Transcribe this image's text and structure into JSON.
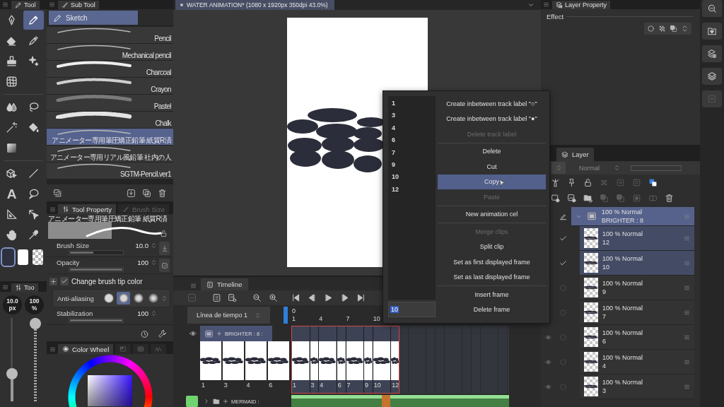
{
  "tool_panel": {
    "title": "Tool",
    "groups": [
      {
        "tools": [
          {
            "kind": "pen",
            "selected": false
          },
          {
            "kind": "pencil",
            "selected": true
          },
          {
            "kind": "eraser",
            "selected": false
          },
          {
            "kind": "marker",
            "selected": false
          },
          {
            "kind": "stamp",
            "selected": false
          },
          {
            "kind": "sparkle",
            "selected": false
          },
          {
            "kind": "mesh",
            "selected": false
          }
        ]
      },
      {
        "tools": [
          {
            "kind": "drops",
            "selected": false
          },
          {
            "kind": "lasso",
            "selected": false
          },
          {
            "kind": "wand",
            "selected": false
          },
          {
            "kind": "bucket",
            "selected": false
          },
          {
            "kind": "gradient",
            "selected": false
          }
        ]
      },
      {
        "tools": [
          {
            "kind": "cube",
            "selected": false
          },
          {
            "kind": "line",
            "selected": false
          },
          {
            "kind": "text",
            "glyph": "A",
            "selected": false
          },
          {
            "kind": "balloon",
            "selected": false
          },
          {
            "kind": "ruler",
            "selected": false
          },
          {
            "kind": "arrow",
            "selected": false
          },
          {
            "kind": "hand",
            "selected": false
          },
          {
            "kind": "dropper",
            "selected": false
          }
        ]
      }
    ],
    "swatches": [
      {
        "kind": "main",
        "color": "#2e3142",
        "selected": true
      },
      {
        "kind": "sub",
        "color": "#ffffff",
        "selected": false
      },
      {
        "kind": "transparent",
        "selected": false
      }
    ]
  },
  "brush_mini": {
    "title": "Too",
    "size": {
      "value": "10.0",
      "unit": "px",
      "level": 0.3
    },
    "opacity": {
      "value": "100",
      "unit": "%",
      "level": 1
    }
  },
  "sub_tool": {
    "title": "Sub Tool",
    "group": {
      "label": "Sketch",
      "selected": true
    },
    "brushes": [
      {
        "name": "Pencil",
        "kind": "thin",
        "selected": false
      },
      {
        "name": "Mechanical pencil",
        "kind": "thin",
        "selected": false
      },
      {
        "name": "Charcoal",
        "kind": "thick",
        "selected": false
      },
      {
        "name": "Crayon",
        "kind": "grainy",
        "selected": false
      },
      {
        "name": "Pastel",
        "kind": "soft",
        "selected": false
      },
      {
        "name": "Chalk",
        "kind": "chalk",
        "selected": false
      },
      {
        "name": "アニメーター専用筆圧矯正鉛筆 紙質R済",
        "kind": "thin",
        "selected": true
      },
      {
        "name": "アニメーター専用リアル風鉛筆 社内の人",
        "kind": "thin",
        "selected": false
      },
      {
        "name": "SGTM-Pencil.ver1",
        "kind": "thin",
        "selected": false
      }
    ]
  },
  "tool_property": {
    "tabs": [
      {
        "label": "Tool Property",
        "selected": true
      },
      {
        "label": "Brush Size",
        "selected": false
      }
    ],
    "preview_name": "アニメーター専用筆圧矯正鉛筆 紙質R済",
    "rows": [
      {
        "kind": "slider",
        "label": "Brush Size",
        "value": "10.0",
        "level": 0.45,
        "button": {
          "kind": "pressure"
        }
      },
      {
        "kind": "slider",
        "label": "Opacity",
        "value": "100",
        "level": 1,
        "button": {
          "kind": "toggle"
        }
      },
      {
        "kind": "checkbox",
        "label": "Change brush tip color",
        "checked": true
      },
      {
        "kind": "options",
        "label": "Anti-aliasing",
        "options": [
          {
            "selected": false
          },
          {
            "selected": true
          },
          {
            "selected": false
          },
          {
            "selected": false
          }
        ]
      },
      {
        "kind": "slider",
        "label": "Stabilization",
        "value": "100",
        "level": 1
      }
    ]
  },
  "color_wheel": {
    "tabs": [
      {
        "kind": "wheel",
        "label": "Color Wheel",
        "selected": true
      },
      {
        "kind": "block",
        "selected": false
      },
      {
        "kind": "grid",
        "selected": false
      },
      {
        "kind": "peaks",
        "selected": false
      }
    ]
  },
  "document": {
    "title": "WATER ANIMATION* (1080 x 1920px 350dpi 43.0%)"
  },
  "timeline": {
    "title": "Timeline",
    "name": "Línea de tiempo 1",
    "ruler_start": "0",
    "ticks": [
      "1",
      "4",
      "7",
      "10"
    ],
    "tracks": [
      {
        "kind": "cels",
        "name": "BRIGHTER : 8 :",
        "selected": true,
        "visible": true,
        "thumbs": [
          "1",
          "3",
          "4",
          "6"
        ],
        "cels": [
          {
            "label": "1",
            "kind": "double"
          },
          {
            "label": "3",
            "kind": "single"
          },
          {
            "label": "4",
            "kind": "double"
          },
          {
            "label": "6",
            "kind": "single"
          },
          {
            "label": "7",
            "kind": "double"
          },
          {
            "label": "9",
            "kind": "single"
          },
          {
            "label": "10",
            "kind": "double"
          },
          {
            "label": "12",
            "kind": "single"
          }
        ]
      },
      {
        "kind": "folder",
        "name": "MERMAID :",
        "selected": false,
        "visible": false,
        "color": "#6fd46f"
      }
    ]
  },
  "context_menu": {
    "frames": [
      "1",
      "3",
      "4",
      "6",
      "7",
      "9",
      "10",
      "12"
    ],
    "frame_input": "10",
    "items": [
      {
        "label": "Create inbetween track label \"○\"",
        "disabled": false,
        "selected": false,
        "divider_before": false
      },
      {
        "label": "Create inbetween track label \"●\"",
        "disabled": false,
        "selected": false,
        "divider_before": false
      },
      {
        "label": "Delete track label",
        "disabled": true,
        "selected": false,
        "divider_before": false
      },
      {
        "label": "Delete",
        "disabled": false,
        "selected": false,
        "divider_before": true
      },
      {
        "label": "Cut",
        "disabled": false,
        "selected": false,
        "divider_before": false
      },
      {
        "label": "Copy",
        "disabled": false,
        "selected": true,
        "divider_before": false
      },
      {
        "label": "Paste",
        "disabled": true,
        "selected": false,
        "divider_before": false
      },
      {
        "label": "New animation cel",
        "disabled": false,
        "selected": false,
        "divider_before": true
      },
      {
        "label": "Merge clips",
        "disabled": true,
        "selected": false,
        "divider_before": true
      },
      {
        "label": "Split clip",
        "disabled": false,
        "selected": false,
        "divider_before": false
      },
      {
        "label": "Set as first displayed frame",
        "disabled": false,
        "selected": false,
        "divider_before": false
      },
      {
        "label": "Set as last displayed frame",
        "disabled": false,
        "selected": false,
        "divider_before": false
      },
      {
        "label": "Insert frame",
        "disabled": false,
        "selected": false,
        "divider_before": true
      },
      {
        "label": "Delete frame",
        "disabled": false,
        "selected": false,
        "divider_before": false
      }
    ]
  },
  "layer_property": {
    "title": "Layer Property",
    "section": "Effect"
  },
  "layer_panel": {
    "title": "Layer",
    "blend_mode": "Normal",
    "layers": [
      {
        "kind": "folder",
        "opacity_mode": "100 % Normal",
        "name": "BRIGHTER : 8",
        "selected": true,
        "expanded": true,
        "editing": true,
        "visible": false,
        "children": [
          {
            "kind": "cel",
            "opacity_mode": "100 % Normal",
            "name": "12",
            "selected": true,
            "editing": false,
            "checked": true,
            "visible": false
          },
          {
            "kind": "cel",
            "opacity_mode": "100 % Normal",
            "name": "10",
            "selected": true,
            "editing": false,
            "checked": true,
            "visible": false
          },
          {
            "kind": "cel",
            "opacity_mode": "100 % Normal",
            "name": "9",
            "selected": false,
            "editing": false,
            "checked": false,
            "visible": false
          },
          {
            "kind": "cel",
            "opacity_mode": "100 % Normal",
            "name": "7",
            "selected": false,
            "editing": false,
            "checked": false,
            "visible": false
          },
          {
            "kind": "cel",
            "opacity_mode": "100 % Normal",
            "name": "6",
            "selected": false,
            "editing": false,
            "checked": false,
            "visible": true
          },
          {
            "kind": "cel",
            "opacity_mode": "100 % Normal",
            "name": "4",
            "selected": false,
            "editing": false,
            "checked": false,
            "visible": true
          },
          {
            "kind": "cel",
            "opacity_mode": "100 % Normal",
            "name": "3",
            "selected": false,
            "editing": false,
            "checked": false,
            "visible": true
          }
        ]
      }
    ]
  }
}
